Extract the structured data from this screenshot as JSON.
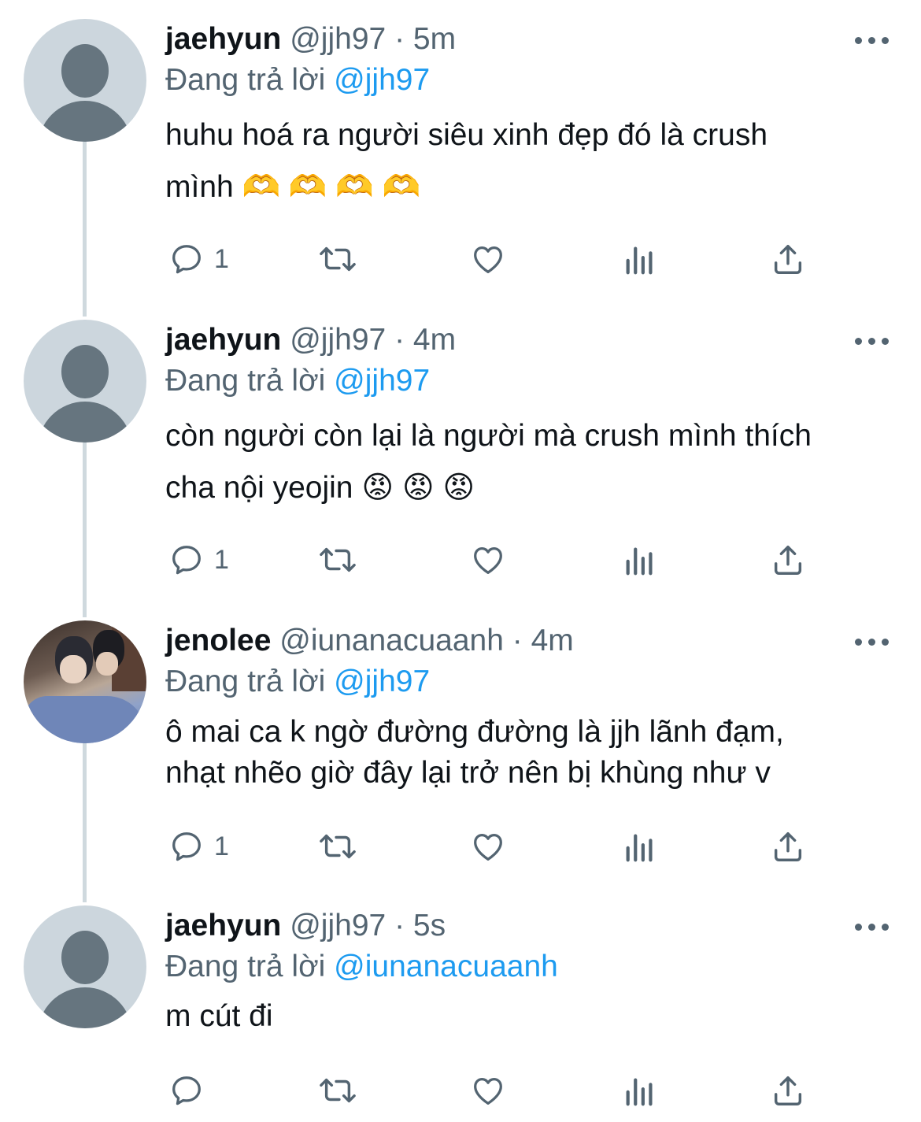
{
  "tweets": [
    {
      "name": "jaehyun",
      "handle": "@jjh97",
      "sep": "·",
      "time": "5m",
      "replying_prefix": "Đang trả lời",
      "replying_to": "@jjh97",
      "text_lines": [
        "huhu hoá ra người siêu xinh đẹp đó là crush",
        "mình 🫶 🫶 🫶 🫶"
      ],
      "reply_count": "1",
      "avatar": "default"
    },
    {
      "name": "jaehyun",
      "handle": "@jjh97",
      "sep": "·",
      "time": "4m",
      "replying_prefix": "Đang trả lời",
      "replying_to": "@jjh97",
      "text_lines": [
        "còn người còn lại là người mà crush mình thích",
        "cha nội yeojin 😡 😡 😡"
      ],
      "reply_count": "1",
      "avatar": "default"
    },
    {
      "name": "jenolee",
      "handle": "@iunanacuaanh",
      "sep": "·",
      "time": "4m",
      "replying_prefix": "Đang trả lời",
      "replying_to": "@jjh97",
      "text_lines": [
        "ô mai ca k ngờ đường đường là jjh lãnh đạm,",
        "nhạt nhẽo giờ đây lại trở nên bị khùng như v"
      ],
      "reply_count": "1",
      "avatar": "photo"
    },
    {
      "name": "jaehyun",
      "handle": "@jjh97",
      "sep": "·",
      "time": "5s",
      "replying_prefix": "Đang trả lời",
      "replying_to": "@iunanacuaanh",
      "text_lines": [
        "m cút đi"
      ],
      "reply_count": "",
      "avatar": "default"
    }
  ],
  "icons": {
    "reply": "reply-icon",
    "retweet": "retweet-icon",
    "like": "heart-icon",
    "analytics": "analytics-icon",
    "share": "share-icon",
    "more": "more-icon"
  },
  "colors": {
    "text": "#0f1419",
    "secondary": "#536471",
    "link": "#1d9bf0",
    "thread_line": "#cfd9de"
  }
}
